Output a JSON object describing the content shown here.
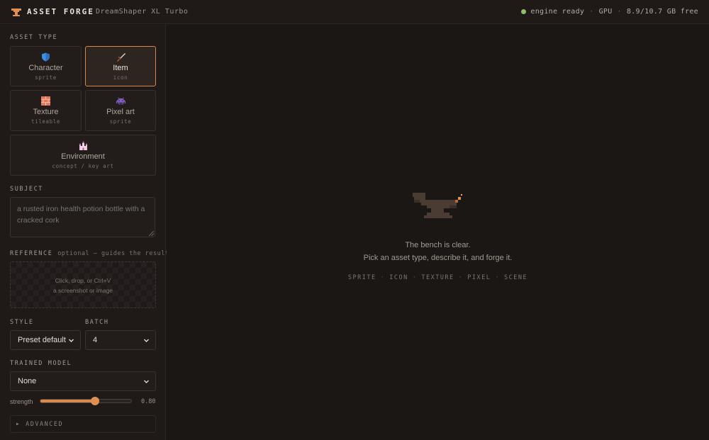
{
  "header": {
    "brand": "ASSET FORGE",
    "model": "DreamShaper XL Turbo",
    "status": "engine ready",
    "gpu_label": "GPU",
    "gpu_memory": "8.9/10.7 GB free"
  },
  "sidebar": {
    "asset_type_label": "ASSET TYPE",
    "types": [
      {
        "name": "Character",
        "sub": "sprite",
        "icon": "shield-icon",
        "selected": false
      },
      {
        "name": "Item",
        "sub": "icon",
        "icon": "dagger-icon",
        "selected": true
      },
      {
        "name": "Texture",
        "sub": "tileable",
        "icon": "brick-icon",
        "selected": false
      },
      {
        "name": "Pixel art",
        "sub": "sprite",
        "icon": "space-invader-icon",
        "selected": false
      },
      {
        "name": "Environment",
        "sub": "concept / key art",
        "icon": "castle-icon",
        "selected": false
      }
    ],
    "subject_label": "SUBJECT",
    "subject_placeholder": "a rusted iron health potion bottle with a cracked cork",
    "reference_label": "REFERENCE",
    "reference_hint": "optional — guides the result",
    "dropzone_line1": "Click, drop, or Ctrl+V",
    "dropzone_line2": "a screenshot or image",
    "style_label": "STYLE",
    "style_value": "Preset default",
    "batch_label": "BATCH",
    "batch_value": "4",
    "trained_model_label": "TRAINED MODEL",
    "trained_model_value": "None",
    "strength_label": "strength",
    "strength_value": "0.80",
    "strength_fraction": 0.6,
    "advanced_label": "ADVANCED"
  },
  "main": {
    "empty_title": "The bench is clear.",
    "empty_subtitle": "Pick an asset type, describe it, and forge it.",
    "kinds": [
      "SPRITE",
      "ICON",
      "TEXTURE",
      "PIXEL",
      "SCENE"
    ]
  },
  "colors": {
    "accent": "#d98a4e",
    "ready": "#8cc265",
    "background": "#1b1714",
    "panel": "#1f1a17"
  }
}
